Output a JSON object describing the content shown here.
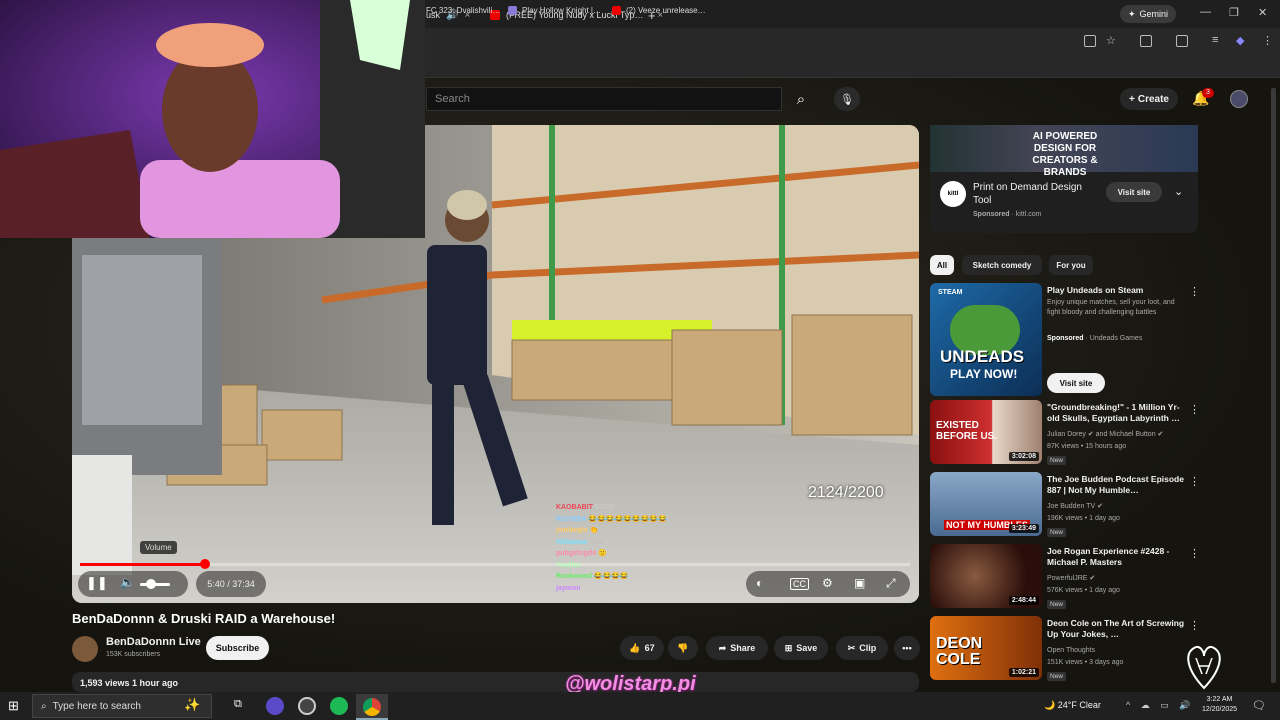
{
  "browser": {
    "tabs": [
      {
        "label": "usk",
        "close": "×"
      },
      {
        "label": "(FREE) Young Nudy x Lucki Typ…",
        "close": "×"
      },
      {
        "label": "+"
      }
    ],
    "gemini_label": "Gemini",
    "window_controls": [
      "—",
      "❐",
      "✕"
    ],
    "bookmarks": [
      {
        "label": "FC 323: Dvalishvili…",
        "color": "#cfcfcf"
      },
      {
        "label": "Play Hollow Knight |…",
        "color": "#8a7ad6"
      },
      {
        "label": "(2) Veeze unrelease…",
        "color": "#e00000"
      }
    ]
  },
  "youtube": {
    "search": {
      "placeholder": "Search"
    },
    "create_label": "Create",
    "notification_count": "3"
  },
  "video": {
    "counter": "2124/2200",
    "time": "5:40 / 37:34",
    "volume_tooltip": "Volume",
    "progress_fraction": 0.151,
    "chat": [
      {
        "user": "KAOBABIT",
        "msg": "BOSS"
      },
      {
        "user": "RichNBA",
        "msg": "😂😂😂😂😂😂😂😂😂"
      },
      {
        "user": "jomlerglo",
        "msg": "👏"
      },
      {
        "user": "HiDaiwan",
        "msg": "chat"
      },
      {
        "user": "pubgirlsgdo",
        "msg": "🙂"
      },
      {
        "user": "Yeatfan",
        "msg": ""
      },
      {
        "user": "Rookwood",
        "msg": "😂😂😂😂"
      },
      {
        "user": "jaymon",
        "msg": ""
      }
    ]
  },
  "meta": {
    "title": "BenDaDonnn & Druski RAID a Warehouse!",
    "channel": "BenDaDonnn Live",
    "subscribers": "153K subscribers",
    "subscribe_label": "Subscribe",
    "likes": "67",
    "share_label": "Share",
    "save_label": "Save",
    "clip_label": "Clip",
    "more": "•••",
    "views_line": "1,593 views  1 hour ago"
  },
  "watermark": "@wolistarp.pi",
  "ad": {
    "banner_text": "AI POWERED DESIGN FOR CREATORS & BRANDS",
    "logo_text": "kittl",
    "title": "Print on Demand Design Tool",
    "sponsored": "Sponsored",
    "domain": "kittl.com",
    "button": "Visit site"
  },
  "chips": [
    "All",
    "Sketch comedy",
    "For you"
  ],
  "promo": {
    "title": "Play Undeads on Steam",
    "desc": "Enjoy unique matches, sell your loot, and fight bloody and challenging battles",
    "sponsored": "Sponsored",
    "advertiser": "Undeads Games",
    "button": "Visit site",
    "thumb_text_1": "UNDEADS",
    "thumb_text_2": "PLAY NOW!",
    "thumb_badge": "STEAM"
  },
  "recommendations": [
    {
      "title": "\"Groundbreaking!\" - 1 Million Yr-old Skulls, Egyptian Labyrinth …",
      "channel": "Julian Dorey ✔ and Michael Button ✔",
      "stats": "87K views • 15 hours ago",
      "duration": "3:02:08",
      "badge": "New",
      "thumb_text": "EXISTED BEFORE US.",
      "thumb_color": "#b01818"
    },
    {
      "title": "The Joe Budden Podcast Episode 887 | Not My Humble…",
      "channel": "Joe Budden TV ✔",
      "stats": "196K views • 1 day ago",
      "duration": "3:23:49",
      "badge": "New",
      "thumb_text": "NOT MY HUMBLES",
      "thumb_color": "#6a8ab0"
    },
    {
      "title": "Joe Rogan Experience #2428 - Michael P. Masters",
      "channel": "PowerfulJRE ✔",
      "stats": "576K views • 1 day ago",
      "duration": "2:48:44",
      "badge": "New",
      "thumb_text": "",
      "thumb_color": "#3a1a14"
    },
    {
      "title": "Deon Cole on The Art of Screwing Up Your Jokes, …",
      "channel": "Open Thoughts",
      "stats": "151K views • 3 days ago",
      "duration": "1:02:21",
      "badge": "New",
      "thumb_text": "DEON COLE",
      "thumb_color": "#c06010"
    }
  ],
  "taskbar": {
    "search_placeholder": "Type here to search",
    "weather": "24°F  Clear",
    "time": "3:22 AM",
    "date": "12/20/2025"
  }
}
